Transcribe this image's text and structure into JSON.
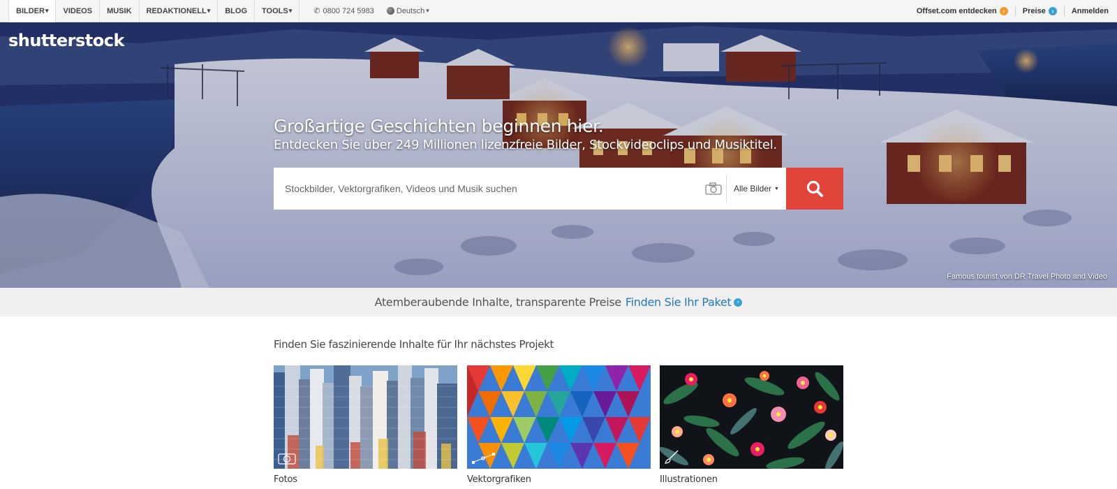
{
  "nav": {
    "items": [
      {
        "label": "BILDER",
        "caret": "▾"
      },
      {
        "label": "VIDEOS",
        "caret": ""
      },
      {
        "label": "MUSIK",
        "caret": ""
      },
      {
        "label": "REDAKTIONELL",
        "caret": "▾"
      },
      {
        "label": "BLOG",
        "caret": ""
      },
      {
        "label": "TOOLS",
        "caret": "▾"
      }
    ],
    "phone": "0800 724 5983",
    "language": "Deutsch",
    "offset_link": "Offset.com entdecken",
    "pricing_link": "Preise",
    "login_link": "Anmelden"
  },
  "hero": {
    "logo": "shutterstock",
    "title": "Großartige Geschichten beginnen hier.",
    "subtitle": "Entdecken Sie über 249 Millionen lizenzfreie Bilder, Stockvideoclips und Musiktitel.",
    "search_placeholder": "Stockbilder, Vektorgrafiken, Videos und Musik suchen",
    "search_scope": "Alle Bilder",
    "credit": "Famous tourist von DR Travel Photo and Video"
  },
  "band": {
    "text": "Atemberaubende Inhalte, transparente Preise",
    "link": "Finden Sie Ihr Paket"
  },
  "section": {
    "title": "Finden Sie faszinierende Inhalte für Ihr nächstes Projekt",
    "cards": [
      {
        "label": "Fotos",
        "icon": "camera-icon"
      },
      {
        "label": "Vektorgrafiken",
        "icon": "pen-tool-icon"
      },
      {
        "label": "Illustrationen",
        "icon": "brush-icon"
      }
    ]
  },
  "colors": {
    "accent_red": "#e0443a",
    "link_blue": "#2478bd",
    "offset_orange": "#f09b2c"
  }
}
